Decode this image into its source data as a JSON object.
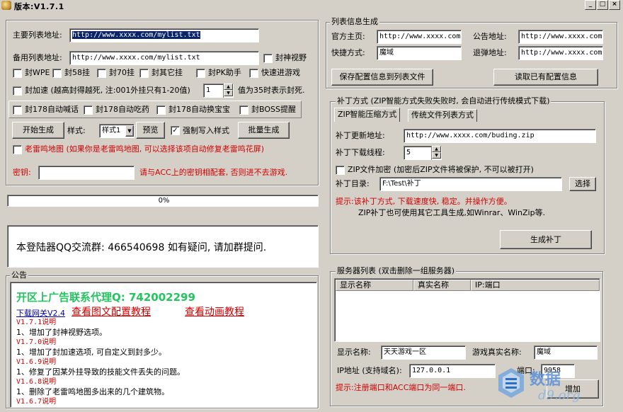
{
  "window": {
    "title": "版本:V1.7.1",
    "min": "_",
    "max": "□",
    "close": "×"
  },
  "left": {
    "main_list_label": "主要列表地址:",
    "main_list_value": "http://www.xxxx.com/mylist.txt",
    "backup_list_label": "备用列表地址:",
    "backup_list_value": "http://www.xxxx.com/mylist.txt",
    "check_vision": "封神视野",
    "row1": [
      "封WPE",
      "封58挂",
      "封70挂",
      "封其它挂",
      "封PK助手",
      "快速进游戏"
    ],
    "speed_label": "封加速 (越高封得越死, 注:001外挂只有1-20值)",
    "speed_value": "1",
    "speed_suffix": "值为35时表示封死.",
    "row3": [
      "封178自动喊话",
      "封178自动吃药",
      "封178自动换宝宝",
      "封BOSS提醒"
    ],
    "start_btn": "开始生成",
    "style_label": "样式:",
    "style_value": "样式1",
    "preview_btn": "预览",
    "force_write": "强制写入样式",
    "batch_btn": "批量生成",
    "thunder_map": "老雷鸣地图 (如果你是老雷鸣地图, 可以选择该项自动修复老雷鸣花屏)",
    "key_label": "密钥:",
    "key_value": "",
    "key_hint": "请与ACC上的密钥相配套, 否则进不去游戏."
  },
  "progress": {
    "text": "0%",
    "value": 0
  },
  "qq_text": "本登陆器QQ交流群: 466540698 如有疑问, 请加群提问.",
  "announcement": {
    "legend": "公告",
    "headline": "开区上广告联系代理Q: 742002299",
    "link_gateway": "下载网关V2.4",
    "link_pic": "查看图文配置教程",
    "link_anim": "查看动画教程",
    "items": [
      {
        "kind": "ver",
        "text": "V1.7.1说明"
      },
      {
        "kind": "txt",
        "text": "1、增加了封神视野选项。"
      },
      {
        "kind": "ver",
        "text": "V1.7.0说明"
      },
      {
        "kind": "txt",
        "text": "1、增加了封加速选项, 可自定义到封多少。"
      },
      {
        "kind": "ver",
        "text": "V1.6.9说明"
      },
      {
        "kind": "txt",
        "text": "1、修复了因某外挂导致的技能文件丢失的问题。"
      },
      {
        "kind": "ver",
        "text": "V1.6.8说明"
      },
      {
        "kind": "txt",
        "text": "1、删除了老雷鸣地图多出来的几个建筑物。"
      },
      {
        "kind": "ver",
        "text": "V1.6.7说明"
      }
    ]
  },
  "right": {
    "legend": "列表信息生成",
    "homepage_label": "官方主页:",
    "homepage_value": "http://www.xxxx.com",
    "notice_label": "公告地址:",
    "notice_value": "http://www.xxxx.com",
    "shortcut_label": "快捷方式:",
    "shortcut_value": "魔域",
    "popup_label": "退弹地址:",
    "popup_value": "http://www.xxxx.com",
    "save_btn": "保存配置信息到列表文件",
    "read_btn": "读取已有配置信息"
  },
  "patch": {
    "legend": "补丁方式 (ZIP智能方式失败失败时, 会自动进行传统模式下载)",
    "tab1": "ZIP智能压缩方式",
    "tab2": "传统文件列表方式",
    "update_label": "补丁更新地址:",
    "update_value": "http://www.xxxx.com/buding.zip",
    "threads_label": "补丁下载线程:",
    "threads_value": "5",
    "encrypt_label": "ZIP文件加密 (加密后ZIP文件将被保护, 不可以被打开)",
    "dir_label": "补丁目录:",
    "dir_value": "F:\\Test\\补丁",
    "browse_btn": "选择",
    "tip1": "提示:该补丁方式, 下载速度快, 稳定。并操作方便。",
    "tip2": "ZIP补丁也可使用其它工具生成,如Winrar、WinZip等.",
    "gen_btn": "生成补丁"
  },
  "servers": {
    "legend": "服务器列表 (双击删除一组服务器)",
    "columns": [
      "显示名称",
      "真实名称",
      "IP:端口"
    ],
    "display_label": "显示名称:",
    "display_value": "天天游戏一区",
    "real_label": "游戏真实名称:",
    "real_value": "魔域",
    "ip_label": "IP地址 (支持域名):",
    "ip_value": "127.0.0.1",
    "port_label": "端口:",
    "port_value": "9958",
    "tip": "提示:注册端口和ACC端口为同一端口.",
    "add_btn": "增加"
  },
  "watermark": {
    "brand": "数据",
    "sub": "d9.org"
  },
  "colors": {
    "face": "#d4d0c8",
    "accent_red": "#d00000",
    "headline_green": "#22c55e",
    "link_blue": "#0000aa"
  }
}
